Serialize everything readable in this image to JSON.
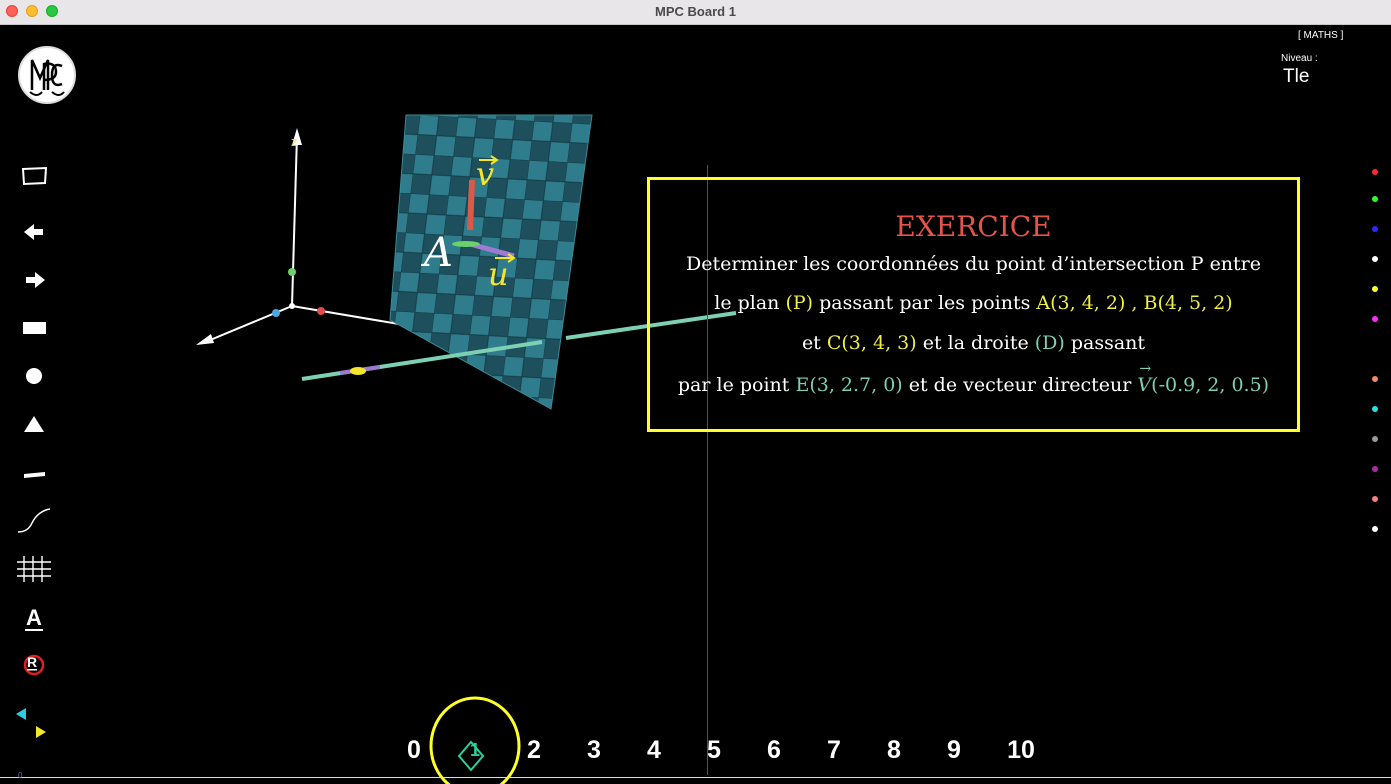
{
  "window": {
    "title": "MPC Board 1"
  },
  "header": {
    "subject": "[  MATHS ]",
    "niveau_label": "Niveau :",
    "niveau_value": "Tle"
  },
  "logo": {
    "letters": "MPC"
  },
  "toolbar": {
    "items": [
      {
        "icon": "rectangle-outline-icon"
      },
      {
        "icon": "arrow-left-icon"
      },
      {
        "icon": "arrow-right-icon"
      },
      {
        "icon": "filled-rectangle-icon"
      },
      {
        "icon": "circle-icon"
      },
      {
        "icon": "triangle-icon"
      },
      {
        "icon": "line-segment-icon"
      },
      {
        "icon": "curve-icon"
      },
      {
        "icon": "grid-icon"
      },
      {
        "icon": "text-icon",
        "label": "A"
      },
      {
        "icon": "reset-icon",
        "label": "R"
      },
      {
        "icon": "color-swap-icon"
      }
    ]
  },
  "palette": [
    "#ff2a2a",
    "#2aff2a",
    "#2a2aff",
    "#ffffff",
    "#ffff2a",
    "#ff2aff",
    "#f08a6a",
    "#2ae0e0",
    "#9a9a9a",
    "#aa2aaa",
    "#f48080",
    "#ffffff"
  ],
  "scene": {
    "point_label": "A",
    "vector_v": "v",
    "vector_u": "u"
  },
  "exercise": {
    "title": "EXERCICE",
    "line1": "Determiner les coordonnées du point d’intersection P entre",
    "line2": {
      "a": "le plan ",
      "b": "(P)",
      "c": " passant par les points ",
      "d": "A(3, 4, 2) , B(4, 5, 2)"
    },
    "line3": {
      "a": "et ",
      "b": "C(3, 4, 3)",
      "c": "  et la droite ",
      "d": "(D)",
      "e": " passant"
    },
    "line4": {
      "a": "par le point ",
      "b": "E(3, 2.7, 0)",
      "c": "  et de vecteur directeur ",
      "d": "V",
      "e": "(-0.9, 2, 0.5)"
    }
  },
  "pages": {
    "numbers": [
      "0",
      "1",
      "2",
      "3",
      "4",
      "5",
      "6",
      "7",
      "8",
      "9",
      "10"
    ],
    "current": "1"
  },
  "colors": {
    "frame": "#ffff2a",
    "title": "#e25548",
    "accent_yellow": "#f1ee46",
    "accent_teal": "#7dd0b3"
  },
  "footer": {
    "corner": "0"
  }
}
